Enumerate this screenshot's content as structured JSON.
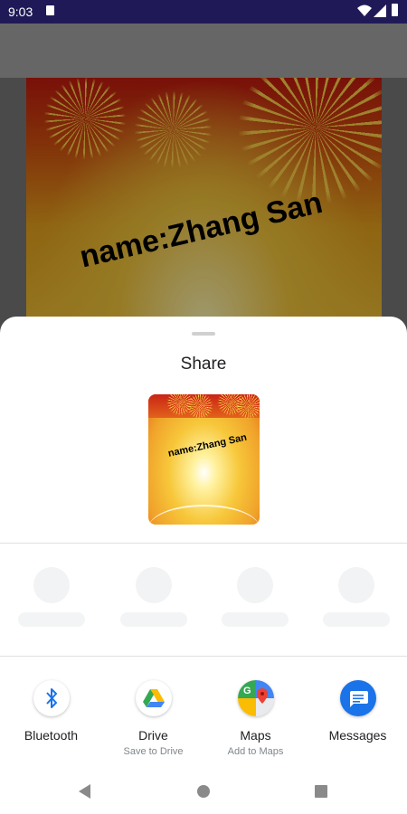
{
  "status_bar": {
    "time": "9:03"
  },
  "background_card": {
    "name_text": "name:Zhang San"
  },
  "share_sheet": {
    "title": "Share",
    "preview": {
      "name_text": "name:Zhang San"
    },
    "app_targets": [
      {
        "label": "Bluetooth",
        "sublabel": "",
        "icon": "bluetooth-icon"
      },
      {
        "label": "Drive",
        "sublabel": "Save to Drive",
        "icon": "google-drive-icon"
      },
      {
        "label": "Maps",
        "sublabel": "Add to Maps",
        "icon": "google-maps-icon"
      },
      {
        "label": "Messages",
        "sublabel": "",
        "icon": "messages-icon"
      }
    ]
  },
  "nav_bar": {
    "back": "back-icon",
    "home": "home-icon",
    "recents": "recents-icon"
  }
}
